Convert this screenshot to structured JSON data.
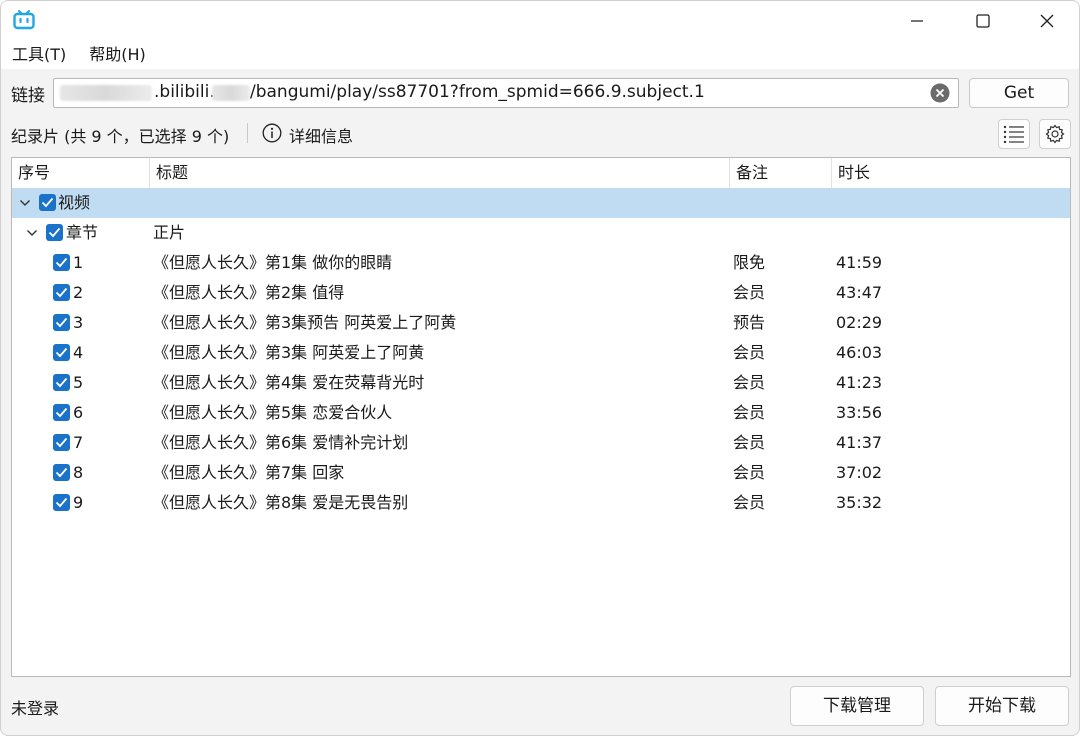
{
  "window": {
    "controls": {
      "minimize": "minimize-icon",
      "maximize": "maximize-icon",
      "close": "close-icon"
    },
    "accent": "#1a73c8"
  },
  "menu": [
    "工具(T)",
    "帮助(H)"
  ],
  "url": {
    "label": "链接",
    "value_part1": ".bilibili.",
    "value_part2": "/bangumi/play/ss87701?from_spmid=666.9.subject.1",
    "get_label": "Get"
  },
  "info": {
    "summary": "纪录片 (共 9 个，已选择 9 个)",
    "detail_label": "详细信息"
  },
  "table": {
    "headers": [
      "序号",
      "标题",
      "备注",
      "时长"
    ],
    "group": {
      "label": "视频"
    },
    "section": {
      "label": "章节",
      "title": "正片"
    },
    "rows": [
      {
        "index": "1",
        "title": "《但愿人长久》第1集 做你的眼睛",
        "note": "限免",
        "duration": "41:59"
      },
      {
        "index": "2",
        "title": "《但愿人长久》第2集 值得",
        "note": "会员",
        "duration": "43:47"
      },
      {
        "index": "3",
        "title": "《但愿人长久》第3集预告 阿英爱上了阿黄",
        "note": "预告",
        "duration": "02:29"
      },
      {
        "index": "4",
        "title": "《但愿人长久》第3集 阿英爱上了阿黄",
        "note": "会员",
        "duration": "46:03"
      },
      {
        "index": "5",
        "title": "《但愿人长久》第4集 爱在荧幕背光时",
        "note": "会员",
        "duration": "41:23"
      },
      {
        "index": "6",
        "title": "《但愿人长久》第5集 恋爱合伙人",
        "note": "会员",
        "duration": "33:56"
      },
      {
        "index": "7",
        "title": "《但愿人长久》第6集 爱情补完计划",
        "note": "会员",
        "duration": "41:37"
      },
      {
        "index": "8",
        "title": "《但愿人长久》第7集 回家",
        "note": "会员",
        "duration": "37:02"
      },
      {
        "index": "9",
        "title": "《但愿人长久》第8集 爱是无畏告别",
        "note": "会员",
        "duration": "35:32"
      }
    ]
  },
  "status": {
    "login": "未登录",
    "download_manager": "下载管理",
    "start_download": "开始下载"
  }
}
